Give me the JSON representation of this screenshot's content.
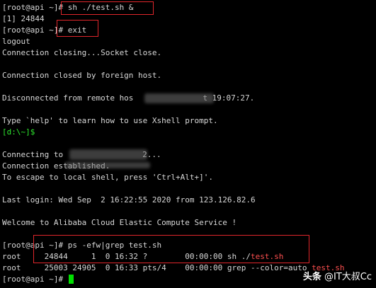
{
  "terminal": {
    "lines": [
      {
        "prompt": "[root@api ~]#",
        "command": " sh ./test.sh &"
      },
      {
        "text": "[1] 24844"
      },
      {
        "prompt": "[root@api ~]#",
        "command": " exit"
      },
      {
        "text": "logout"
      },
      {
        "text": "Connection closing...Socket close."
      },
      {
        "text": ""
      },
      {
        "text": "Connection closed by foreign host."
      },
      {
        "text": ""
      },
      {
        "text": "Disconnected from remote hos",
        "text_tail": "t 19:07:27."
      },
      {
        "text": ""
      },
      {
        "text": "Type `help' to learn how to use Xshell prompt."
      },
      {
        "local_prompt": "[d:\\~]$"
      },
      {
        "text": ""
      },
      {
        "text": "Connecting to",
        "text_tail": "2..."
      },
      {
        "text": "Connection established."
      },
      {
        "text": "To escape to local shell, press 'Ctrl+Alt+]'."
      },
      {
        "text": ""
      },
      {
        "text": "Last login: Wed Sep  2 16:22:55 2020 from 123.126.82.6"
      },
      {
        "text": ""
      },
      {
        "text": "Welcome to Alibaba Cloud Elastic Compute Service !"
      },
      {
        "text": ""
      },
      {
        "prompt": "[root@api ~]#",
        "command": " ps -efw|grep test.sh"
      },
      {
        "text": "root     24844     1  0 16:32 ?        00:00:00 sh ./",
        "highlight": "test.sh"
      },
      {
        "text": "root     25003 24905  0 16:33 pts/4    00:00:00 grep --color=auto ",
        "highlight": "test.sh"
      },
      {
        "prompt": "[root@api ~]#",
        "command": " "
      }
    ]
  },
  "watermark": {
    "prefix": "头条",
    "author": " @IT大叔Cc"
  },
  "colors": {
    "background": "#000000",
    "text": "#d8d8d8",
    "local_prompt": "#2ee82e",
    "highlight": "#ff5050",
    "annotation_box": "#e0262b",
    "cursor": "#00e000"
  }
}
